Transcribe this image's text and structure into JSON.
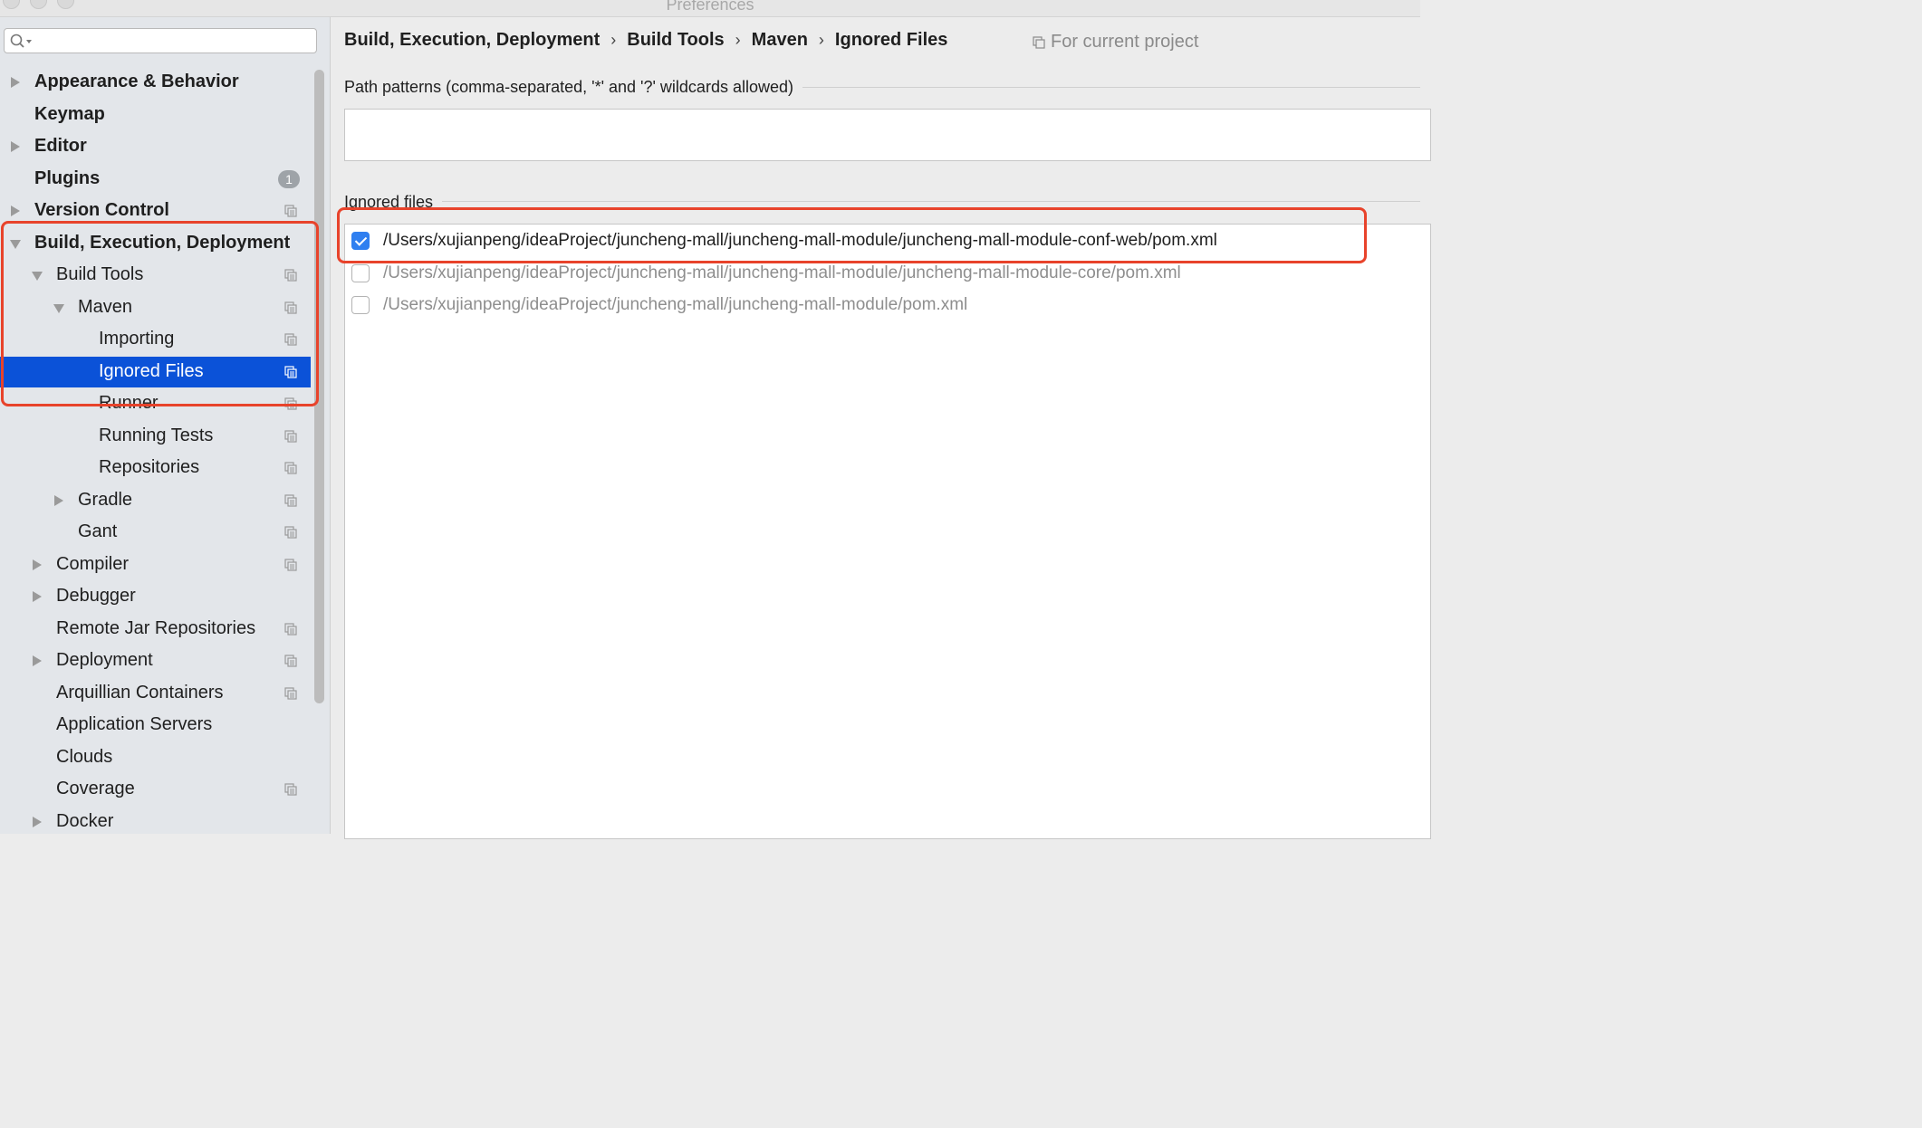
{
  "window": {
    "title": "Preferences"
  },
  "search": {
    "placeholder": ""
  },
  "sidebar": {
    "items": [
      {
        "label": "Appearance & Behavior",
        "bold": true,
        "arrow": "right",
        "indent": 0
      },
      {
        "label": "Keymap",
        "bold": true,
        "arrow": "none",
        "indent": 0
      },
      {
        "label": "Editor",
        "bold": true,
        "arrow": "right",
        "indent": 0
      },
      {
        "label": "Plugins",
        "bold": true,
        "arrow": "none",
        "indent": 0,
        "badge": "1"
      },
      {
        "label": "Version Control",
        "bold": true,
        "arrow": "right",
        "indent": 0,
        "copy": true
      },
      {
        "label": "Build, Execution, Deployment",
        "bold": true,
        "arrow": "down",
        "indent": 0
      },
      {
        "label": "Build Tools",
        "bold": false,
        "arrow": "down",
        "indent": 1,
        "copy": true
      },
      {
        "label": "Maven",
        "bold": false,
        "arrow": "down",
        "indent": 2,
        "copy": true
      },
      {
        "label": "Importing",
        "bold": false,
        "arrow": "none",
        "indent": 3,
        "copy": true
      },
      {
        "label": "Ignored Files",
        "bold": false,
        "arrow": "none",
        "indent": 3,
        "copy": true,
        "selected": true
      },
      {
        "label": "Runner",
        "bold": false,
        "arrow": "none",
        "indent": 3,
        "copy": true
      },
      {
        "label": "Running Tests",
        "bold": false,
        "arrow": "none",
        "indent": 3,
        "copy": true
      },
      {
        "label": "Repositories",
        "bold": false,
        "arrow": "none",
        "indent": 3,
        "copy": true
      },
      {
        "label": "Gradle",
        "bold": false,
        "arrow": "right",
        "indent": 2,
        "copy": true
      },
      {
        "label": "Gant",
        "bold": false,
        "arrow": "none",
        "indent": 2,
        "copy": true
      },
      {
        "label": "Compiler",
        "bold": false,
        "arrow": "right",
        "indent": 1,
        "copy": true
      },
      {
        "label": "Debugger",
        "bold": false,
        "arrow": "right",
        "indent": 1
      },
      {
        "label": "Remote Jar Repositories",
        "bold": false,
        "arrow": "none",
        "indent": 1,
        "copy": true
      },
      {
        "label": "Deployment",
        "bold": false,
        "arrow": "right",
        "indent": 1,
        "copy": true
      },
      {
        "label": "Arquillian Containers",
        "bold": false,
        "arrow": "none",
        "indent": 1,
        "copy": true
      },
      {
        "label": "Application Servers",
        "bold": false,
        "arrow": "none",
        "indent": 1
      },
      {
        "label": "Clouds",
        "bold": false,
        "arrow": "none",
        "indent": 1
      },
      {
        "label": "Coverage",
        "bold": false,
        "arrow": "none",
        "indent": 1,
        "copy": true
      },
      {
        "label": "Docker",
        "bold": false,
        "arrow": "right",
        "indent": 1
      }
    ]
  },
  "breadcrumb": {
    "items": [
      "Build, Execution, Deployment",
      "Build Tools",
      "Maven",
      "Ignored Files"
    ],
    "separator": "›",
    "scope": "For current project"
  },
  "path_patterns": {
    "label": "Path patterns (comma-separated, '*' and '?' wildcards allowed)",
    "value": ""
  },
  "ignored_files": {
    "label": "Ignored files",
    "files": [
      {
        "path": "/Users/xujianpeng/ideaProject/juncheng-mall/juncheng-mall-module/juncheng-mall-module-conf-web/pom.xml",
        "checked": true
      },
      {
        "path": "/Users/xujianpeng/ideaProject/juncheng-mall/juncheng-mall-module/juncheng-mall-module-core/pom.xml",
        "checked": false
      },
      {
        "path": "/Users/xujianpeng/ideaProject/juncheng-mall/juncheng-mall-module/pom.xml",
        "checked": false
      }
    ]
  },
  "colors": {
    "selection": "#0b52d8",
    "annotation": "#e8432b",
    "checkbox": "#2f7ff0"
  }
}
